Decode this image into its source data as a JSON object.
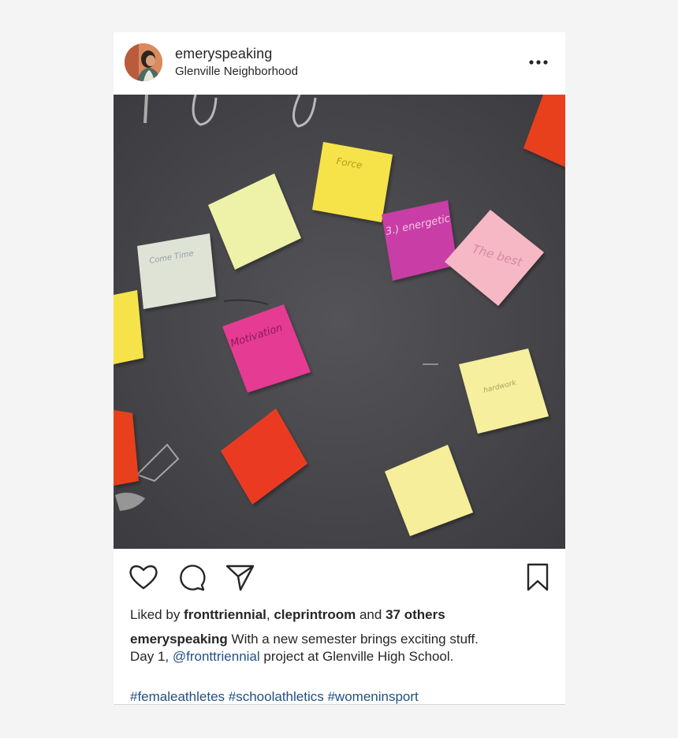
{
  "post": {
    "username": "emeryspeaking",
    "location": "Glenville Neighborhood",
    "more_icon": "more-horizontal-icon",
    "photo_notes": [
      "Come Time",
      "Force",
      "3.) energetic",
      "The best",
      "Motivation",
      "hardwork"
    ]
  },
  "actions": {
    "icons": [
      "heart-icon",
      "comment-icon",
      "share-icon",
      "bookmark-icon"
    ]
  },
  "likes": {
    "prefix": "Liked by ",
    "user1": "fronttriennial",
    "separator": ", ",
    "user2": "cleprintroom",
    "middle": " and ",
    "others": "37 others"
  },
  "caption": {
    "username": "emeryspeaking",
    "text1": " With a new semester brings exciting stuff.",
    "text2": "Day 1, ",
    "mention": "@fronttriennial",
    "text3": " project at Glenville High School."
  },
  "hashtags": [
    "#femaleathletes",
    "#schoolathletics",
    "#womeninsport"
  ],
  "colors": {
    "text": "#262626",
    "link": "#1f4f82",
    "chalkboard": "#4a4a4d"
  }
}
